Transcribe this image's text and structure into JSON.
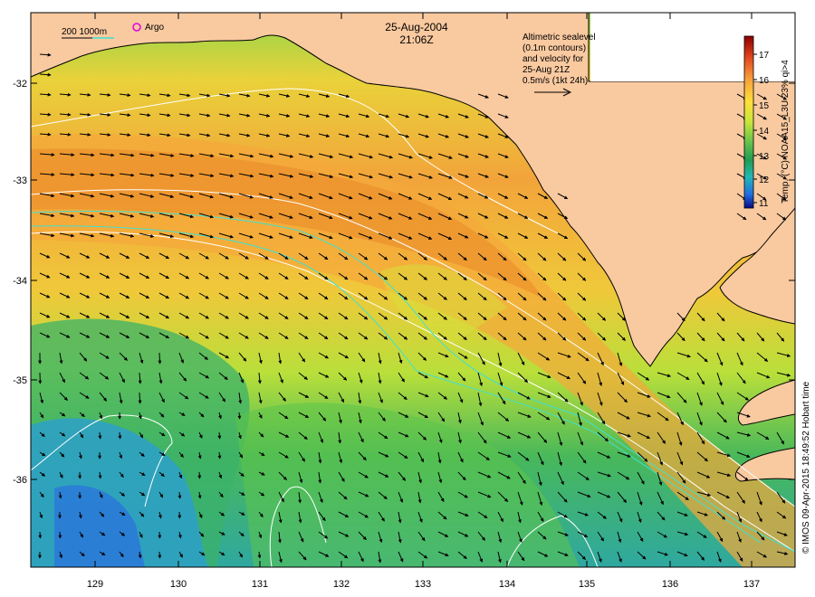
{
  "header": {
    "date": "25-Aug-2004",
    "time": "21:06Z"
  },
  "scale_legend": {
    "label": "200  1000m",
    "argo_label": "Argo"
  },
  "velocity_note": {
    "lines": [
      "Altimetric sealevel",
      "(0.1m contours)",
      "and velocity for",
      "25-Aug 21Z",
      "0.5m/s (1kt 24h)"
    ]
  },
  "colorbar": {
    "title": "Temp. (°C) NOAA15_L3U 23% qi>4",
    "ticks": [
      "17",
      "16",
      "15",
      "14",
      "13",
      "12",
      "11"
    ],
    "colors": [
      "#8b0000",
      "#d7301f",
      "#f46d43",
      "#fdae61",
      "#fee08b",
      "#d9ef8b",
      "#a6d96a",
      "#66bd63",
      "#1a9850",
      "#2ab5a5",
      "#1e90ff",
      "#0033cc",
      "#000080"
    ]
  },
  "axes": {
    "x_ticks": [
      "129",
      "130",
      "131",
      "132",
      "133",
      "134",
      "135",
      "136",
      "137"
    ],
    "y_ticks": [
      "-32",
      "-33",
      "-34",
      "-35",
      "-36"
    ]
  },
  "credit": "© IMOS 09-Apr-2015 18:49:52 Hobart time",
  "palette": {
    "land": "#f9c9a0",
    "warm": "#f0a020",
    "mid": "#cfe020",
    "cool": "#4cc05a",
    "cold": "#2a9ad8",
    "contour": "#ffffff",
    "isobath": "#40e0d0",
    "arrow": "#000000"
  }
}
